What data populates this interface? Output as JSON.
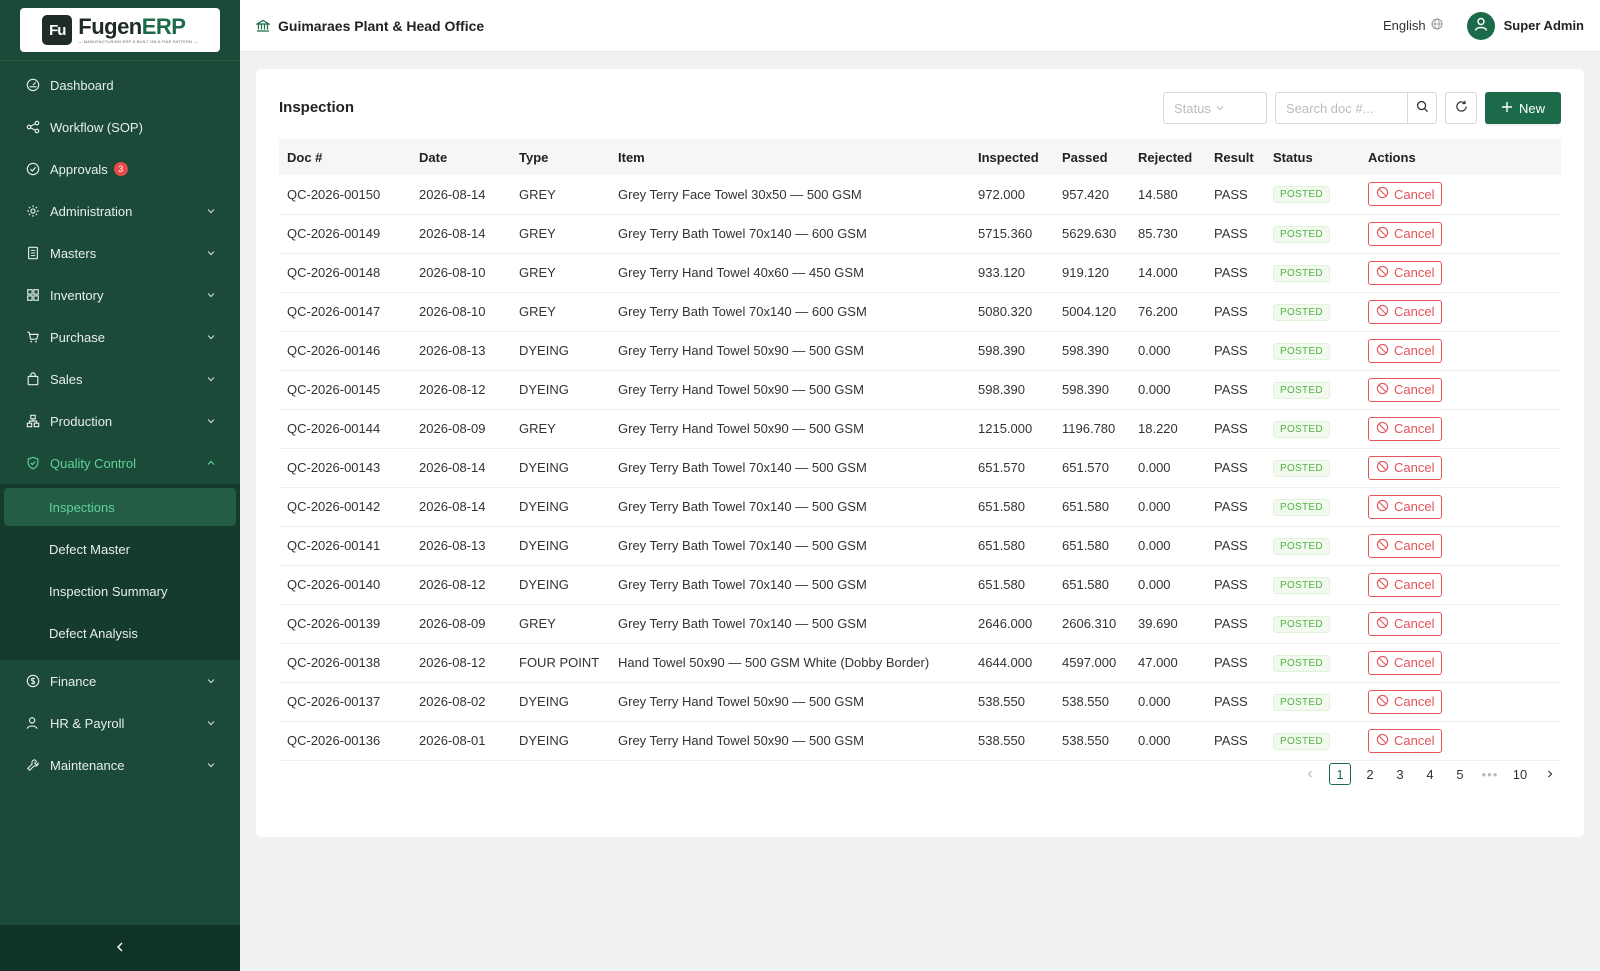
{
  "app": {
    "logo_mark": "Fu",
    "logo_name_a": "Fugen",
    "logo_name_b": "ERP",
    "logo_tagline": "— MANUFACTURING ERP & BUILT ON A FINE PATTERN —"
  },
  "sidebar": {
    "items": [
      {
        "label": "Dashboard",
        "icon": "dashboard-icon"
      },
      {
        "label": "Workflow (SOP)",
        "icon": "workflow-icon"
      },
      {
        "label": "Approvals",
        "icon": "check-circle-icon",
        "badge": "3"
      },
      {
        "label": "Administration",
        "icon": "gear-icon"
      },
      {
        "label": "Masters",
        "icon": "book-icon"
      },
      {
        "label": "Inventory",
        "icon": "grid-icon"
      },
      {
        "label": "Purchase",
        "icon": "cart-icon"
      },
      {
        "label": "Sales",
        "icon": "bag-icon"
      },
      {
        "label": "Production",
        "icon": "cluster-icon"
      },
      {
        "label": "Quality Control",
        "icon": "shield-check-icon"
      },
      {
        "label": "Finance",
        "icon": "dollar-icon"
      },
      {
        "label": "HR & Payroll",
        "icon": "user-icon"
      },
      {
        "label": "Maintenance",
        "icon": "wrench-icon"
      }
    ],
    "qc_sub": [
      {
        "label": "Inspections"
      },
      {
        "label": "Defect Master"
      },
      {
        "label": "Inspection Summary"
      },
      {
        "label": "Defect Analysis"
      }
    ]
  },
  "header": {
    "org": "Guimaraes Plant & Head Office",
    "language": "English",
    "user": "Super Admin"
  },
  "main": {
    "title": "Inspection",
    "status_placeholder": "Status",
    "search_placeholder": "Search doc #...",
    "new_label": "New",
    "columns": [
      "Doc #",
      "Date",
      "Type",
      "Item",
      "Inspected",
      "Passed",
      "Rejected",
      "Result",
      "Status",
      "Actions"
    ],
    "cancel_label": "Cancel",
    "rows": [
      {
        "doc": "QC-2026-00150",
        "date": "2026-08-14",
        "type": "GREY",
        "item": "Grey Terry Face Towel 30x50 — 500 GSM",
        "inspected": "972.000",
        "passed": "957.420",
        "rejected": "14.580",
        "result": "PASS",
        "status": "POSTED"
      },
      {
        "doc": "QC-2026-00149",
        "date": "2026-08-14",
        "type": "GREY",
        "item": "Grey Terry Bath Towel 70x140 — 600 GSM",
        "inspected": "5715.360",
        "passed": "5629.630",
        "rejected": "85.730",
        "result": "PASS",
        "status": "POSTED"
      },
      {
        "doc": "QC-2026-00148",
        "date": "2026-08-10",
        "type": "GREY",
        "item": "Grey Terry Hand Towel 40x60 — 450 GSM",
        "inspected": "933.120",
        "passed": "919.120",
        "rejected": "14.000",
        "result": "PASS",
        "status": "POSTED"
      },
      {
        "doc": "QC-2026-00147",
        "date": "2026-08-10",
        "type": "GREY",
        "item": "Grey Terry Bath Towel 70x140 — 600 GSM",
        "inspected": "5080.320",
        "passed": "5004.120",
        "rejected": "76.200",
        "result": "PASS",
        "status": "POSTED"
      },
      {
        "doc": "QC-2026-00146",
        "date": "2026-08-13",
        "type": "DYEING",
        "item": "Grey Terry Hand Towel 50x90 — 500 GSM",
        "inspected": "598.390",
        "passed": "598.390",
        "rejected": "0.000",
        "result": "PASS",
        "status": "POSTED"
      },
      {
        "doc": "QC-2026-00145",
        "date": "2026-08-12",
        "type": "DYEING",
        "item": "Grey Terry Hand Towel 50x90 — 500 GSM",
        "inspected": "598.390",
        "passed": "598.390",
        "rejected": "0.000",
        "result": "PASS",
        "status": "POSTED"
      },
      {
        "doc": "QC-2026-00144",
        "date": "2026-08-09",
        "type": "GREY",
        "item": "Grey Terry Hand Towel 50x90 — 500 GSM",
        "inspected": "1215.000",
        "passed": "1196.780",
        "rejected": "18.220",
        "result": "PASS",
        "status": "POSTED"
      },
      {
        "doc": "QC-2026-00143",
        "date": "2026-08-14",
        "type": "DYEING",
        "item": "Grey Terry Bath Towel 70x140 — 500 GSM",
        "inspected": "651.570",
        "passed": "651.570",
        "rejected": "0.000",
        "result": "PASS",
        "status": "POSTED"
      },
      {
        "doc": "QC-2026-00142",
        "date": "2026-08-14",
        "type": "DYEING",
        "item": "Grey Terry Bath Towel 70x140 — 500 GSM",
        "inspected": "651.580",
        "passed": "651.580",
        "rejected": "0.000",
        "result": "PASS",
        "status": "POSTED"
      },
      {
        "doc": "QC-2026-00141",
        "date": "2026-08-13",
        "type": "DYEING",
        "item": "Grey Terry Bath Towel 70x140 — 500 GSM",
        "inspected": "651.580",
        "passed": "651.580",
        "rejected": "0.000",
        "result": "PASS",
        "status": "POSTED"
      },
      {
        "doc": "QC-2026-00140",
        "date": "2026-08-12",
        "type": "DYEING",
        "item": "Grey Terry Bath Towel 70x140 — 500 GSM",
        "inspected": "651.580",
        "passed": "651.580",
        "rejected": "0.000",
        "result": "PASS",
        "status": "POSTED"
      },
      {
        "doc": "QC-2026-00139",
        "date": "2026-08-09",
        "type": "GREY",
        "item": "Grey Terry Bath Towel 70x140 — 500 GSM",
        "inspected": "2646.000",
        "passed": "2606.310",
        "rejected": "39.690",
        "result": "PASS",
        "status": "POSTED"
      },
      {
        "doc": "QC-2026-00138",
        "date": "2026-08-12",
        "type": "FOUR POINT",
        "item": "Hand Towel 50x90 — 500 GSM White (Dobby Border)",
        "inspected": "4644.000",
        "passed": "4597.000",
        "rejected": "47.000",
        "result": "PASS",
        "status": "POSTED"
      },
      {
        "doc": "QC-2026-00137",
        "date": "2026-08-02",
        "type": "DYEING",
        "item": "Grey Terry Hand Towel 50x90 — 500 GSM",
        "inspected": "538.550",
        "passed": "538.550",
        "rejected": "0.000",
        "result": "PASS",
        "status": "POSTED"
      },
      {
        "doc": "QC-2026-00136",
        "date": "2026-08-01",
        "type": "DYEING",
        "item": "Grey Terry Hand Towel 50x90 — 500 GSM",
        "inspected": "538.550",
        "passed": "538.550",
        "rejected": "0.000",
        "result": "PASS",
        "status": "POSTED"
      }
    ],
    "pagination": {
      "pages": [
        "1",
        "2",
        "3",
        "4",
        "5"
      ],
      "ellipsis": "•••",
      "last": "10",
      "current": "1"
    }
  },
  "colors": {
    "sidebar_bg": "#1b4a38",
    "accent": "#1b6b4a",
    "active_text": "#5fd39a",
    "danger": "#e2555a",
    "posted": "#52b044"
  }
}
